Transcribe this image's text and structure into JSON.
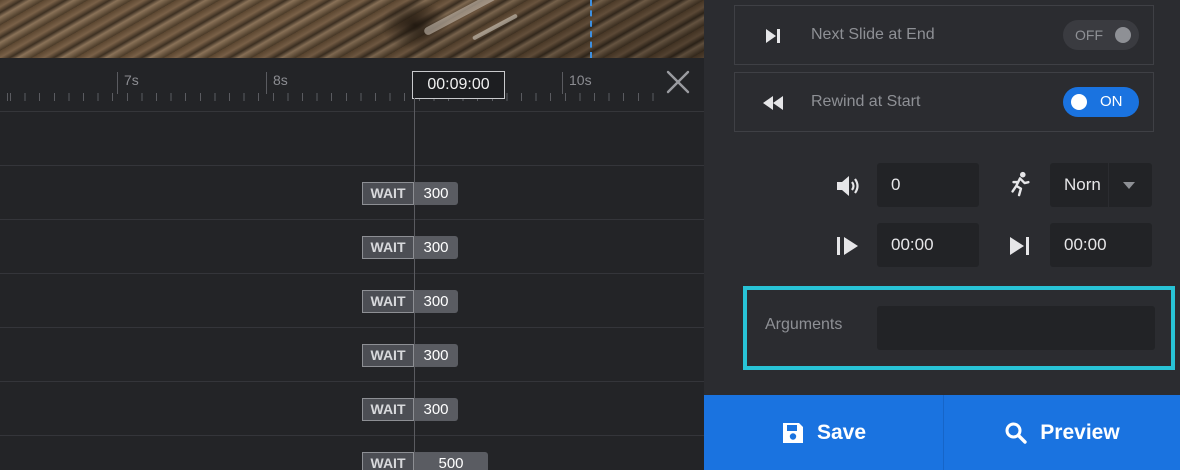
{
  "timeline": {
    "ruler_labels": [
      "7s",
      "8s",
      "10s"
    ],
    "timecode": "00:09:00",
    "tracks": [
      {
        "wait_label": "WAIT",
        "value": "300"
      },
      {
        "wait_label": "WAIT",
        "value": "300"
      },
      {
        "wait_label": "WAIT",
        "value": "300"
      },
      {
        "wait_label": "WAIT",
        "value": "300"
      },
      {
        "wait_label": "WAIT",
        "value": "300"
      },
      {
        "wait_label": "WAIT",
        "value": "500"
      }
    ]
  },
  "panel": {
    "next_slide": {
      "label": "Next Slide at End",
      "toggle": "OFF",
      "icon": "skip-next-icon"
    },
    "rewind": {
      "label": "Rewind at Start",
      "toggle": "ON",
      "icon": "rewind-icon"
    },
    "volume": {
      "value": "0",
      "icon": "volume-icon"
    },
    "speed": {
      "value": "Norn",
      "icon": "running-person-icon"
    },
    "start_time": {
      "value": "00:00",
      "icon": "play-start-icon"
    },
    "end_time": {
      "value": "00:00",
      "icon": "skip-end-icon"
    },
    "arguments": {
      "label": "Arguments",
      "value": "",
      "highlight_color": "#28c3d6"
    }
  },
  "actions": {
    "save_label": "Save",
    "preview_label": "Preview",
    "accent": "#1a73e0"
  }
}
